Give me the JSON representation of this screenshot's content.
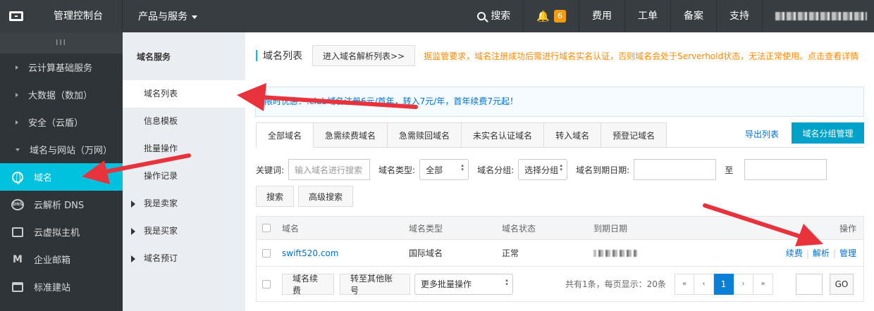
{
  "topbar": {
    "console_title": "管理控制台",
    "products_label": "产品与服务",
    "search_label": "搜索",
    "notification_count": "6",
    "billing_label": "费用",
    "ticket_label": "工单",
    "record_label": "备案",
    "support_label": "支持"
  },
  "sidebar": {
    "toggle_label": "III",
    "groups": [
      {
        "label": "云计算基础服务"
      },
      {
        "label": "大数据（数加）"
      },
      {
        "label": "安全（云盾）"
      },
      {
        "label": "域名与网站（万网）"
      }
    ],
    "items": [
      {
        "label": "域名",
        "icon": "globe-icon"
      },
      {
        "label": "云解析 DNS",
        "icon": "dns-icon"
      },
      {
        "label": "云虚拟主机",
        "icon": "server-icon"
      },
      {
        "label": "企业邮箱",
        "icon": "mail-icon"
      },
      {
        "label": "标准建站",
        "icon": "site-icon"
      }
    ]
  },
  "subnav": {
    "title": "域名服务",
    "items": [
      "域名列表",
      "信息模板",
      "批量操作",
      "操作记录"
    ],
    "groups": [
      "我是卖家",
      "我是买家",
      "域名预订"
    ]
  },
  "main": {
    "title": "域名列表",
    "enter_dns_button": "进入域名解析列表>>",
    "warning": "据监管要求，域名注册成功后需进行域名实名认证，否则域名会处于Serverhold状态，无法正常使用。点击查看详情",
    "promo": "限时优惠：.club域名注册6元/首年，转入7元/年，首年续费7元起！",
    "tabs": [
      "全部域名",
      "急需续费域名",
      "急需赎回域名",
      "未实名认证域名",
      "转入域名",
      "预登记域名"
    ],
    "export_link": "导出列表",
    "group_manage_button": "域名分组管理",
    "filters": {
      "keyword_label": "关键词:",
      "keyword_placeholder": "输入域名进行搜索",
      "type_label": "域名类型:",
      "type_value": "全部",
      "group_label": "域名分组:",
      "group_value": "选择分组",
      "expiry_label": "域名到期日期:",
      "to_label": "至"
    },
    "search_button": "搜索",
    "advanced_search_button": "高级搜索",
    "table": {
      "columns": [
        "域名",
        "域名类型",
        "域名状态",
        "到期日期",
        "操作"
      ],
      "rows": [
        {
          "domain": "swift520.com",
          "type": "国际域名",
          "status": "正常"
        }
      ],
      "actions": [
        "续费",
        "解析",
        "管理"
      ]
    },
    "footer": {
      "renew_button": "域名续费",
      "transfer_button": "转至其他账号",
      "more_ops_value": "更多批量操作",
      "summary": "共有1条，每页显示：20条",
      "current_page": "1",
      "first": "«",
      "prev": "‹",
      "next": "›",
      "last": "»",
      "go_button": "GO"
    }
  },
  "colors": {
    "topbar": "#373d41",
    "sidebar": "#2f3438",
    "accent": "#00c1de",
    "primary_button": "#00a2ca",
    "link": "#0070cc",
    "warning": "#ff8a00",
    "annotation_arrow": "#e8323c"
  }
}
